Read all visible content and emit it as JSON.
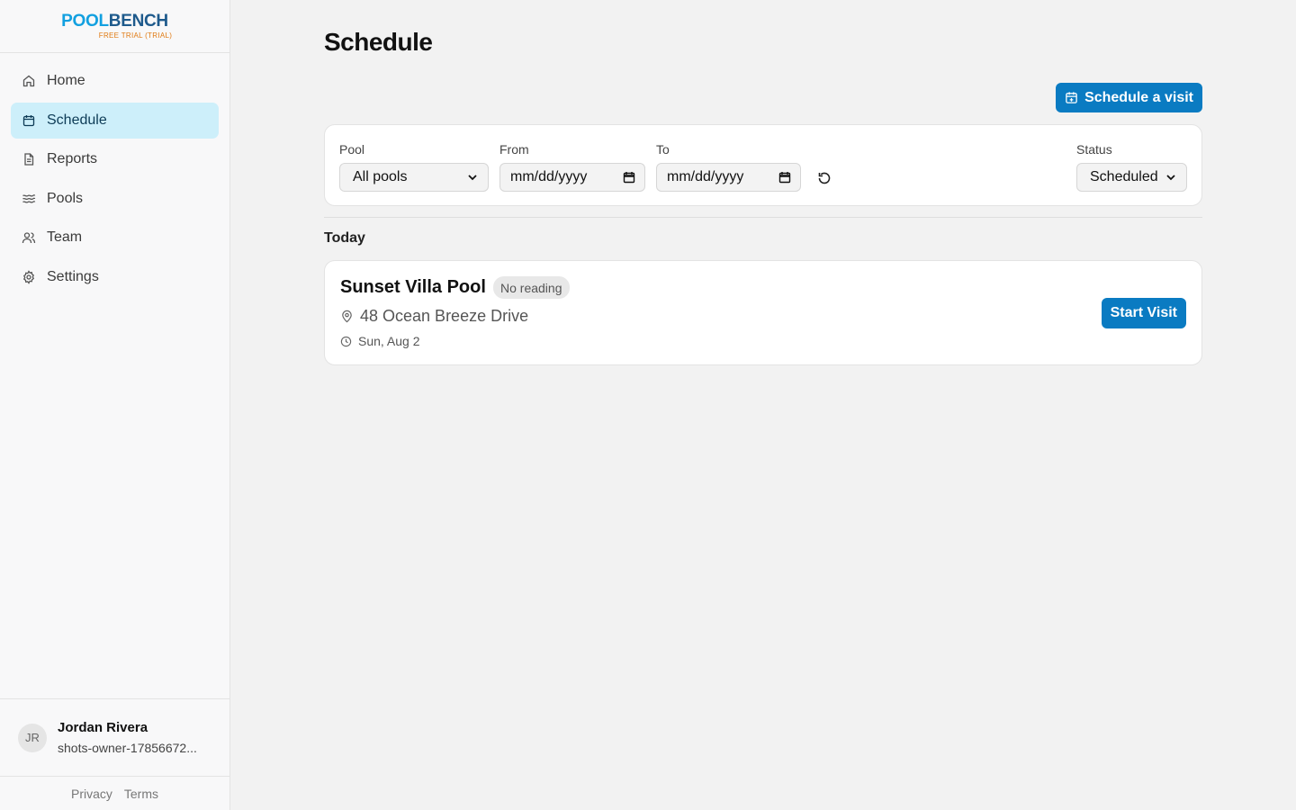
{
  "brand": {
    "name_part1": "POOL",
    "name_part2": "BENCH",
    "tagline": "FREE TRIAL (TRIAL)"
  },
  "sidebar": {
    "items": [
      {
        "label": "Home",
        "icon": "home-icon"
      },
      {
        "label": "Schedule",
        "icon": "calendar-icon",
        "active": true
      },
      {
        "label": "Reports",
        "icon": "document-icon"
      },
      {
        "label": "Pools",
        "icon": "waves-icon"
      },
      {
        "label": "Team",
        "icon": "users-icon"
      },
      {
        "label": "Settings",
        "icon": "gear-icon"
      }
    ]
  },
  "user": {
    "initials": "JR",
    "name": "Jordan Rivera",
    "email": "shots-owner-17856672..."
  },
  "footer": {
    "privacy": "Privacy",
    "terms": "Terms"
  },
  "page": {
    "title": "Schedule",
    "schedule_button": "Schedule a visit"
  },
  "filters": {
    "pool": {
      "label": "Pool",
      "value": "All pools"
    },
    "from": {
      "label": "From",
      "placeholder": "mm/dd/yyyy"
    },
    "to": {
      "label": "To",
      "placeholder": "mm/dd/yyyy"
    },
    "status": {
      "label": "Status",
      "value": "Scheduled"
    }
  },
  "section": {
    "label": "Today"
  },
  "visits": [
    {
      "title": "Sunset Villa Pool",
      "badge": "No reading",
      "address": "48 Ocean Breeze Drive",
      "date": "Sun, Aug 2",
      "action": "Start Visit"
    }
  ],
  "colors": {
    "accent": "#0a7bc2",
    "active_nav_bg": "#cdeffa",
    "brand_light": "#12a0e0",
    "brand_dark": "#1e5a8c",
    "trial_orange": "#e07a12"
  }
}
